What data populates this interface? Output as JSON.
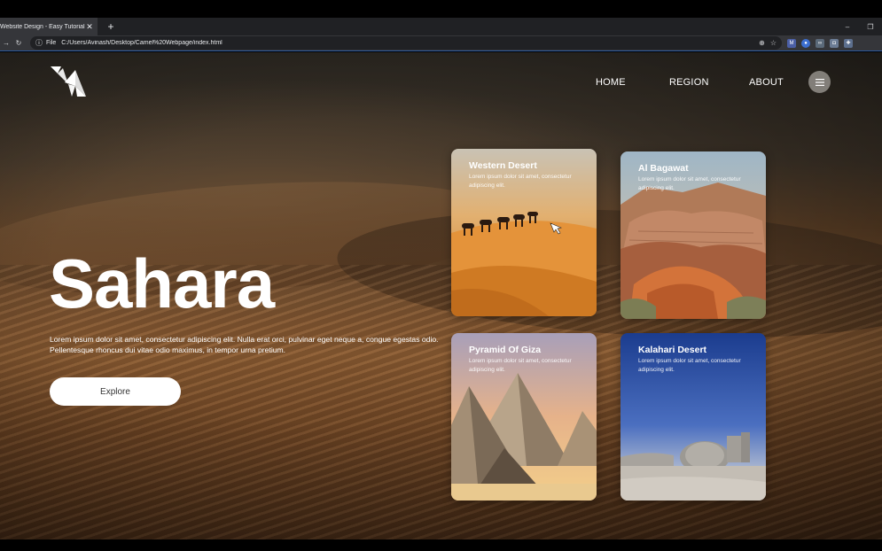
{
  "browser": {
    "tab_title": "Website Design - Easy Tutorials",
    "tab_close": "✕",
    "new_tab": "+",
    "scheme_label": "File",
    "url": "C:/Users/Avinash/Desktop/Camel%20Webpage/index.html"
  },
  "header": {
    "nav": [
      {
        "label": "HOME"
      },
      {
        "label": "REGION"
      },
      {
        "label": "ABOUT"
      }
    ]
  },
  "hero": {
    "title": "Sahara",
    "text": "Lorem ipsum dolor sit amet, consectetur adipiscing elit. Nulla erat orci, pulvinar eget neque a, congue egestas odio. Pellentesque rhoncus dui vitae odio maximus, in tempor urna pretium.",
    "button_label": "Explore"
  },
  "cards": [
    {
      "title": "Western Desert",
      "desc": "Lorem ipsum dolor sit amet, consectetur adipiscing elit."
    },
    {
      "title": "Al Bagawat",
      "desc": "Lorem ipsum dolor sit amet, consectetur adipiscing elit."
    },
    {
      "title": "Pyramid Of Giza",
      "desc": "Lorem ipsum dolor sit amet, consectetur adipiscing elit."
    },
    {
      "title": "Kalahari Desert",
      "desc": "Lorem ipsum dolor sit amet, consectetur adipiscing elit."
    }
  ],
  "colors": {
    "tab_bar": "#202124",
    "address_bar": "#35363a",
    "accent_line": "#2b5a9f",
    "button_bg": "#ffffff",
    "text_light": "#ffffff"
  }
}
